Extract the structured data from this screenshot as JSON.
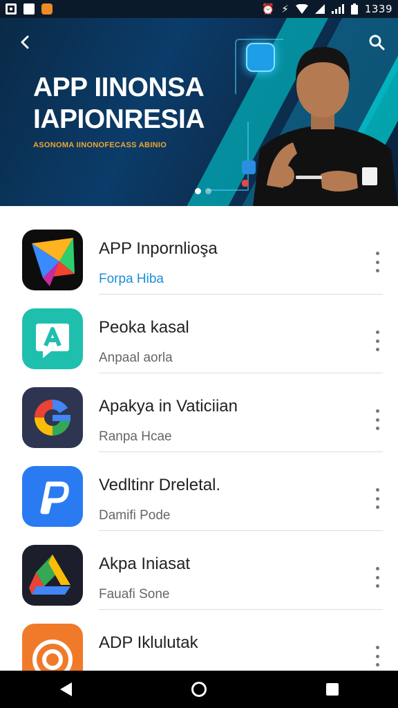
{
  "status_bar": {
    "left_icons": [
      "photo-icon",
      "notes-icon",
      "notification-app-icon"
    ],
    "right_icons": [
      "alarm-icon",
      "vibrate-icon",
      "wifi-icon",
      "signal-icon",
      "signal-bars-icon",
      "battery-icon"
    ],
    "time": "1339"
  },
  "hero": {
    "title_line1": "APP IINONSA",
    "title_line2": "IAPIONRESIA",
    "subtitle": "ASONOMA IINONOFECASS ABINIO",
    "carousel_page": 1,
    "carousel_total": 2
  },
  "apps": [
    {
      "title": "APP Inpornlioşa",
      "subtitle": "Forpa Hiba",
      "subtitle_is_link": true,
      "icon": "star-app-icon"
    },
    {
      "title": "Peoka kasal",
      "subtitle": "Anpaаl aorla",
      "subtitle_is_link": false,
      "icon": "a-letter-app-icon"
    },
    {
      "title": "Apakya  in Vaticiian",
      "subtitle": "Ranpa Hcae",
      "subtitle_is_link": false,
      "icon": "g-letter-app-icon"
    },
    {
      "title": "Vedltinr Dreletal.",
      "subtitle": "Damifi Pode",
      "subtitle_is_link": false,
      "icon": "p-letter-app-icon"
    },
    {
      "title": "Akpa Iniasat",
      "subtitle": "Fauafi Sone",
      "subtitle_is_link": false,
      "icon": "drive-triangle-app-icon"
    },
    {
      "title": "ADP Iklulutak",
      "subtitle": "",
      "subtitle_is_link": false,
      "icon": "target-app-icon"
    }
  ],
  "colors": {
    "hero_bg": "#0b3c6a",
    "hero_accent": "#00dcdc",
    "subtitle_accent": "#f2a531",
    "link": "#1a8fd6"
  }
}
